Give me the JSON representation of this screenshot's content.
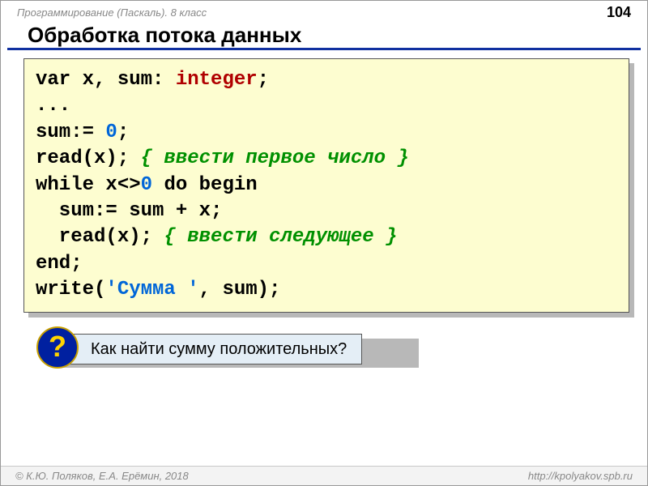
{
  "header": {
    "breadcrumb": "Программирование (Паскаль). 8 класс",
    "page_number": "104"
  },
  "title": "Обработка потока данных",
  "code": {
    "line1": {
      "a": "var",
      "b": " x, sum: ",
      "c": "integer",
      "d": ";"
    },
    "line2": "...",
    "line3": {
      "a": "sum:= ",
      "b": "0",
      "c": ";"
    },
    "line4": {
      "a": "read(x); ",
      "b": "{ ввести первое число }"
    },
    "line5": {
      "a": "while",
      "b": " x<>",
      "c": "0",
      "d": " ",
      "e": "do begin"
    },
    "line6": "  sum:= sum + x;",
    "line7": {
      "a": "  read(x); ",
      "b": "{ ввести следующее }"
    },
    "line8": {
      "a": "end",
      "b": ";"
    },
    "line9": {
      "a": "write(",
      "b": "'Сумма '",
      "c": ", sum);"
    }
  },
  "question": {
    "badge": "?",
    "text": " Как найти сумму положительных?"
  },
  "footer": {
    "left": "© К.Ю. Поляков, Е.А. Ерёмин, 2018",
    "right": "http://kpolyakov.spb.ru"
  }
}
